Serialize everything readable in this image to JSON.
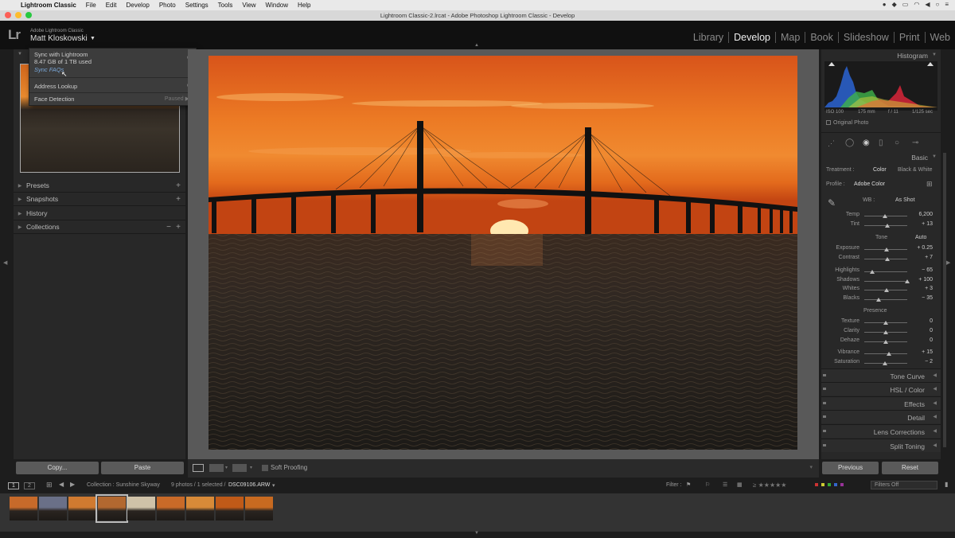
{
  "menubar": {
    "app": "Lightroom Classic",
    "items": [
      "File",
      "Edit",
      "Develop",
      "Photo",
      "Settings",
      "Tools",
      "View",
      "Window",
      "Help"
    ]
  },
  "titlebar": {
    "title": "Lightroom Classic-2.lrcat - Adobe Photoshop Lightroom Classic - Develop"
  },
  "identity": {
    "logo": "Lr",
    "product": "Adobe Lightroom Classic",
    "user": "Matt Kloskowski"
  },
  "modules": [
    {
      "label": "Library"
    },
    {
      "label": "Develop",
      "active": true
    },
    {
      "label": "Map"
    },
    {
      "label": "Book"
    },
    {
      "label": "Slideshow"
    },
    {
      "label": "Print"
    },
    {
      "label": "Web"
    }
  ],
  "popup": {
    "sync": "Sync with Lightroom",
    "storage": "8.47 GB of 1 TB used",
    "faqs": "Sync FAQs",
    "address": "Address Lookup",
    "face": "Face Detection",
    "face_status": "Paused"
  },
  "left_panel": {
    "sections": [
      {
        "label": "Presets",
        "action": "+"
      },
      {
        "label": "Snapshots",
        "action": "+"
      },
      {
        "label": "History",
        "action": ""
      },
      {
        "label": "Collections",
        "action": "+",
        "minus": "−"
      }
    ],
    "copy": "Copy...",
    "paste": "Paste"
  },
  "toolbar": {
    "soft_proofing": "Soft Proofing"
  },
  "right_panel": {
    "histogram_title": "Histogram",
    "hist_info": {
      "iso": "ISO 100",
      "focal": "175 mm",
      "aperture": "f / 11",
      "shutter": "1/125 sec"
    },
    "original_photo": "Original Photo",
    "basic_title": "Basic",
    "treatment_label": "Treatment :",
    "treatment_color": "Color",
    "treatment_bw": "Black & White",
    "profile_label": "Profile :",
    "profile_value": "Adobe Color",
    "wb_label": "WB :",
    "wb_value": "As Shot",
    "tone_label": "Tone",
    "auto": "Auto",
    "presence_label": "Presence",
    "sliders": [
      {
        "label": "Temp",
        "value": "6,200",
        "pos": 0.48
      },
      {
        "label": "Tint",
        "value": "+ 13",
        "pos": 0.54
      },
      {
        "label": "Exposure",
        "value": "+ 0.25",
        "pos": 0.52
      },
      {
        "label": "Contrast",
        "value": "+ 7",
        "pos": 0.53
      },
      {
        "label": "Highlights",
        "value": "− 65",
        "pos": 0.18
      },
      {
        "label": "Shadows",
        "value": "+ 100",
        "pos": 1.0
      },
      {
        "label": "Whites",
        "value": "+ 3",
        "pos": 0.51
      },
      {
        "label": "Blacks",
        "value": "− 35",
        "pos": 0.33
      },
      {
        "label": "Texture",
        "value": "0",
        "pos": 0.5
      },
      {
        "label": "Clarity",
        "value": "0",
        "pos": 0.5
      },
      {
        "label": "Dehaze",
        "value": "0",
        "pos": 0.5
      },
      {
        "label": "Vibrance",
        "value": "+ 15",
        "pos": 0.57
      },
      {
        "label": "Saturation",
        "value": "− 2",
        "pos": 0.49
      }
    ],
    "sections": [
      "Tone Curve",
      "HSL / Color",
      "Effects",
      "Detail",
      "Lens Corrections",
      "Split Toning"
    ],
    "previous": "Previous",
    "reset": "Reset"
  },
  "filmbar": {
    "page1": "1",
    "page2": "2",
    "collection": "Collection : Sunshine Skyway",
    "count": "9 photos / 1 selected /",
    "file": "DSC09106.ARW",
    "filter_label": "Filter :",
    "filters_off": "Filters Off"
  },
  "thumb_colors": [
    "#c76a2a",
    "#6a7088",
    "#d07a30",
    "#b26830",
    "#cfc2a8",
    "#c96a28",
    "#d88a38",
    "#c05a18",
    "#c86a20"
  ],
  "colors": {
    "accent": "#e6e6e6",
    "panel": "#282828",
    "center_bg": "#595959"
  }
}
